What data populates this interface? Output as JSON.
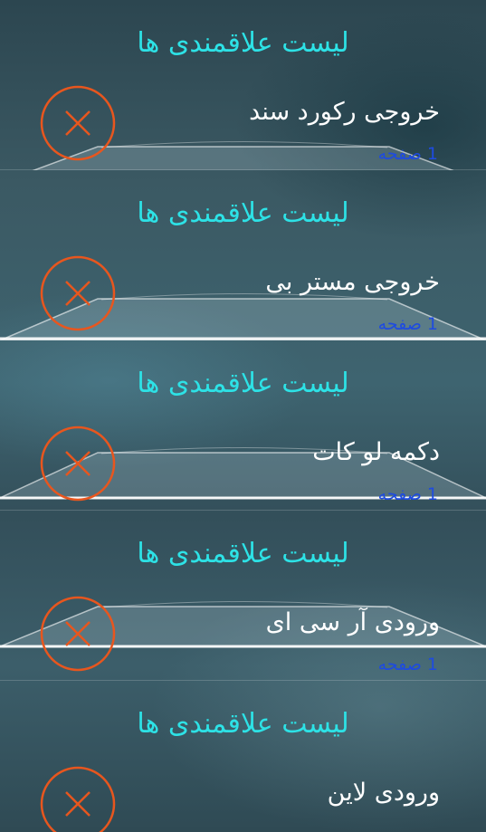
{
  "favorites": {
    "items": [
      {
        "header": "لیست علاقمندی ها",
        "name": "خروجی رکورد سند",
        "pages": "1 صفحه"
      },
      {
        "header": "لیست علاقمندی ها",
        "name": "خروجی مستر بی",
        "pages": "1 صفحه"
      },
      {
        "header": "لیست علاقمندی ها",
        "name": "دکمه لو کات",
        "pages": "1 صفحه"
      },
      {
        "header": "لیست علاقمندی ها",
        "name": "ورودی آر سی ای",
        "pages": "1 صفحه"
      },
      {
        "header": "لیست علاقمندی ها",
        "name": "ورودی لاین",
        "pages": ""
      }
    ]
  },
  "colors": {
    "header_text": "#2de2e6",
    "item_text": "#ffffff",
    "pages_text": "#1e4be0",
    "delete_icon": "#e8561e"
  },
  "icons": {
    "delete": "close-circle-icon"
  }
}
